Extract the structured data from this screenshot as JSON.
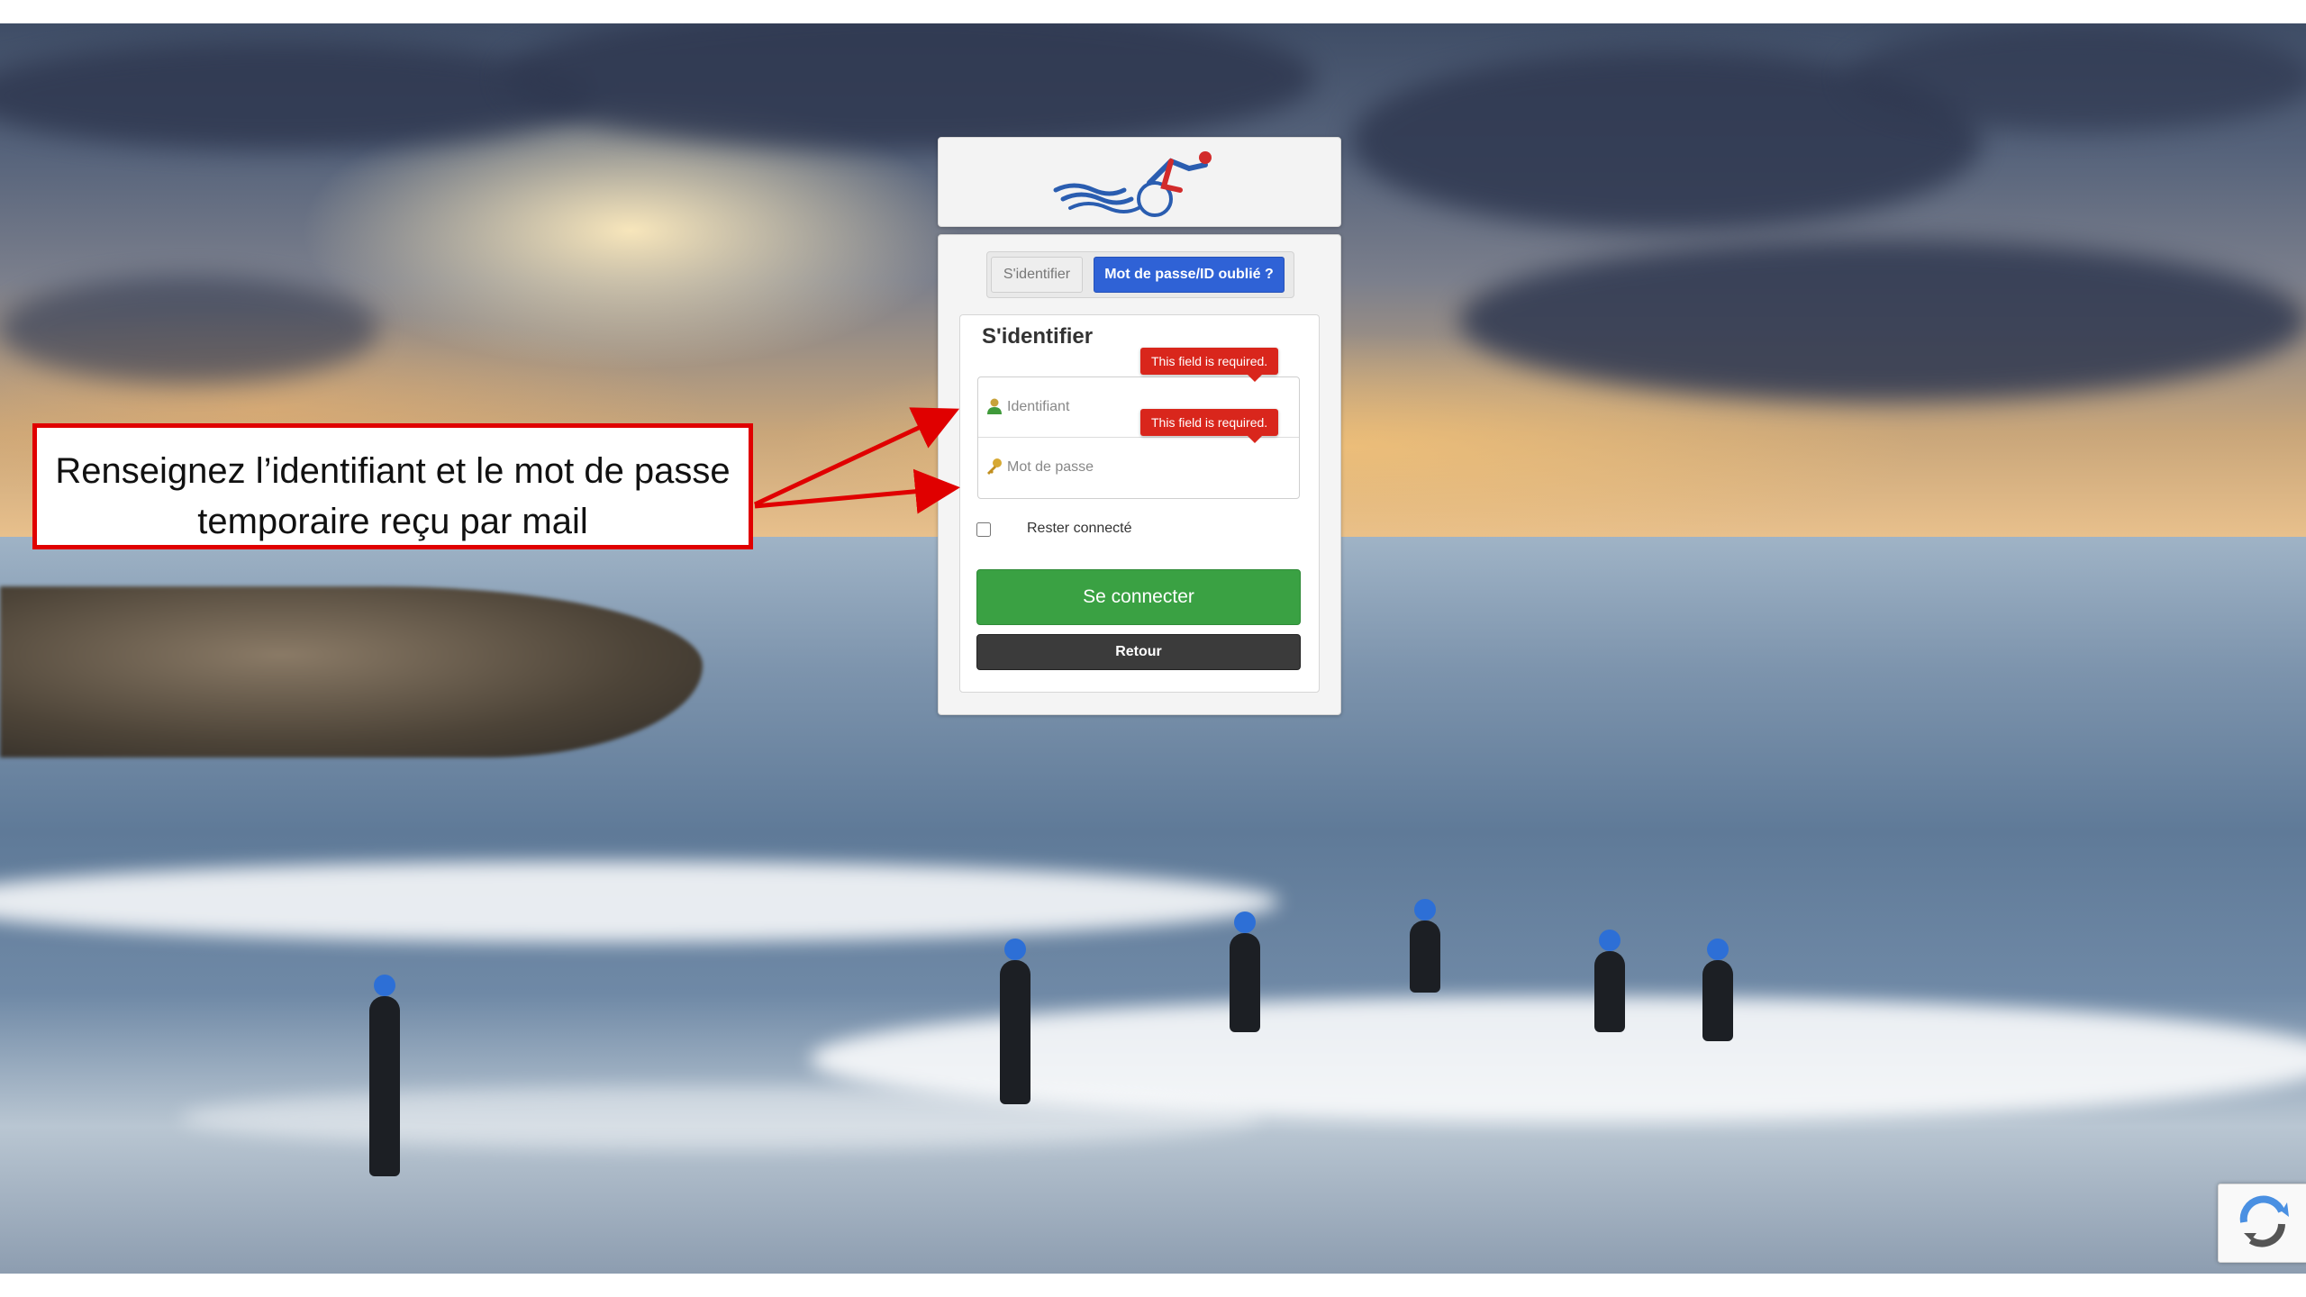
{
  "login": {
    "tabs": {
      "login_label": "S'identifier",
      "forgot_label": "Mot de passe/ID oublié ?"
    },
    "panel_title": "S'identifier",
    "username": {
      "placeholder": "Identifiant",
      "error": "This field is required."
    },
    "password": {
      "placeholder": "Mot de passe",
      "error": "This field is required."
    },
    "remember_label": "Rester connecté",
    "connect_label": "Se connecter",
    "back_label": "Retour"
  },
  "annotation": {
    "text": "Renseignez l’identifiant et le mot de passe temporaire reçu par mail",
    "color": "#e00000"
  },
  "colors": {
    "tab_active": "#2f62d6",
    "connect_button": "#3aa143",
    "back_button": "#3b3b3b",
    "error": "#d9261c"
  },
  "icons": {
    "logo": "triathlon-logo-icon",
    "user": "user-icon",
    "key": "key-icon",
    "recaptcha": "recaptcha-icon"
  }
}
